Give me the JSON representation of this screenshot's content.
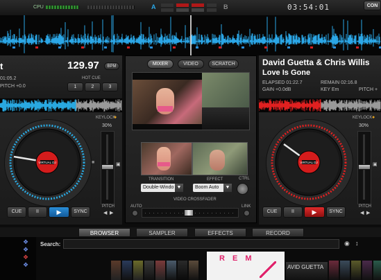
{
  "topbar": {
    "cpu_label": "CPU",
    "deck_a_label": "A",
    "deck_b_label": "B",
    "clock": "03:54:01",
    "config_label": "CON"
  },
  "deck_left": {
    "title_fragment": "t",
    "bpm": "129.97",
    "bpm_badge": "BPM",
    "time_fragment": "01:05.2",
    "pitch_label": "PITCH +0.0",
    "hot_cue_label": "HOT CUE",
    "hot_cues": [
      "1",
      "2",
      "3"
    ],
    "keylock_label": "KEYLOCK",
    "keylock_value": "30%",
    "pitch_slider_label": "PITCH",
    "cue_label": "CUE",
    "pause_label": "II",
    "play_label": "▶",
    "sync_label": "SYNC",
    "accent": "#29a8e0"
  },
  "deck_right": {
    "artist": "David Guetta & Chris Willis",
    "title": "Love Is Gone",
    "elapsed": "ELAPSED 01:22.7",
    "remain": "REMAIN 02:16.8",
    "gain": "GAIN +0.0dB",
    "key": "KEY Em",
    "pitch_fragment": "PITCH +",
    "keylock_label": "KEYLOCK",
    "keylock_value": "30%",
    "pitch_slider_label": "PITCH",
    "cue_label": "CUE",
    "pause_label": "II",
    "play_label": "▶",
    "sync_label": "SYNC",
    "accent": "#e02020"
  },
  "center": {
    "tabs": [
      "MIXER",
      "VIDEO",
      "SCRATCH"
    ],
    "transition_label": "TRANSITION",
    "transition_value": "Double-Windo",
    "effect_label": "EFFECT",
    "effect_value": "Boom Auto",
    "ctrl_label": "CTRL",
    "crossfader_label": "VIDEO CROSSFADER",
    "auto_label": "AUTO",
    "link_label": "LINK"
  },
  "bottom_tabs": [
    "BROWSER",
    "SAMPLER",
    "EFFECTS",
    "RECORD"
  ],
  "browser": {
    "search_label": "Search:",
    "search_value": "",
    "covers": {
      "rem": "R E M",
      "guetta": "AVID GUETTA"
    }
  }
}
